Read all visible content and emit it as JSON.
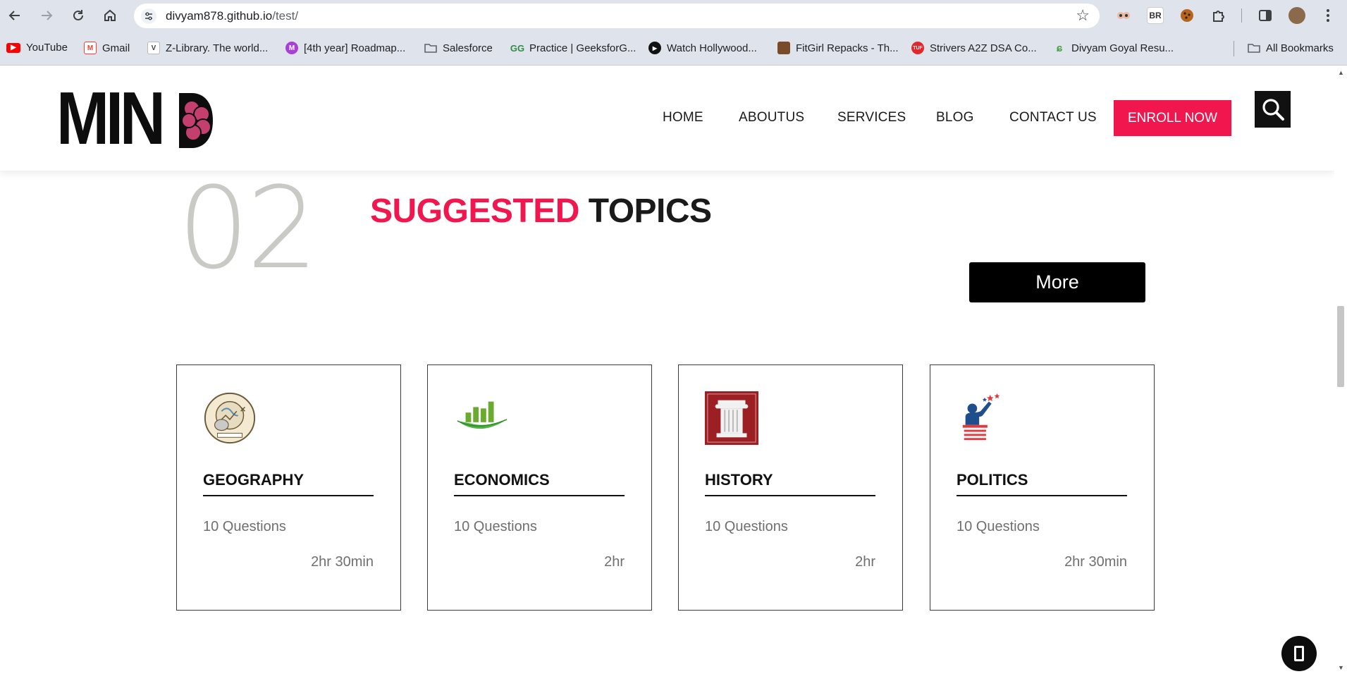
{
  "browser": {
    "url_host": "divyam878.github.io",
    "url_path": "/test/",
    "extensions": [
      "BR"
    ],
    "bookmarks": [
      {
        "label": "YouTube",
        "icon": "youtube-icon",
        "color": "#ff0000"
      },
      {
        "label": "Gmail",
        "icon": "gmail-icon",
        "color": "#ea4335"
      },
      {
        "label": "Z-Library. The world...",
        "icon": "zlibrary-icon",
        "color": "#444444"
      },
      {
        "label": "[4th year] Roadmap...",
        "icon": "notion-m-icon",
        "color": "#a93fd9"
      },
      {
        "label": "Salesforce",
        "icon": "folder-icon",
        "color": "#5f6368"
      },
      {
        "label": "Practice | GeeksforG...",
        "icon": "geeksforgeeks-icon",
        "color": "#2f8d46"
      },
      {
        "label": "Watch Hollywood...",
        "icon": "play-icon",
        "color": "#111111"
      },
      {
        "label": "FitGirl Repacks - Th...",
        "icon": "fitgirl-icon",
        "color": "#7a4b2a"
      },
      {
        "label": "Strivers A2Z DSA Co...",
        "icon": "tuf-icon",
        "color": "#e3262b"
      },
      {
        "label": "Divyam Goyal Resu...",
        "icon": "overleaf-icon",
        "color": "#47a141"
      }
    ],
    "all_bookmarks_label": "All Bookmarks"
  },
  "site": {
    "logo_text": "MIN",
    "nav": [
      "HOME",
      "ABOUTUS",
      "SERVICES",
      "BLOG",
      "CONTACT US"
    ],
    "enroll_label": "ENROLL NOW",
    "brand_color": "#f2164f"
  },
  "section": {
    "number": "02",
    "title_accent": "SUGGESTED",
    "title_rest": "TOPICS",
    "more_label": "More"
  },
  "topics": [
    {
      "title": "GEOGRAPHY",
      "questions": "10 Questions",
      "duration": "2hr 30min",
      "icon": "geography-icon"
    },
    {
      "title": "ECONOMICS",
      "questions": "10 Questions",
      "duration": "2hr",
      "icon": "economics-icon"
    },
    {
      "title": "HISTORY",
      "questions": "10 Questions",
      "duration": "2hr",
      "icon": "history-icon"
    },
    {
      "title": "POLITICS",
      "questions": "10 Questions",
      "duration": "2hr 30min",
      "icon": "politics-icon"
    }
  ]
}
